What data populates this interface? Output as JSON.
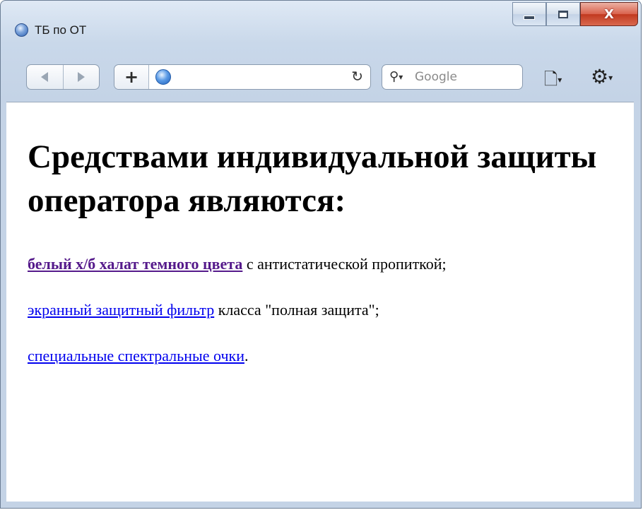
{
  "window": {
    "title": "ТБ по ОТ",
    "controls": {
      "minimize": "minimize",
      "maximize": "maximize",
      "close": "X"
    }
  },
  "toolbar": {
    "plus_label": "+",
    "reload_label": "↻",
    "search_placeholder": "Google"
  },
  "page": {
    "heading": "Средствами индивидуальной защиты оператора являются:",
    "items": [
      {
        "link": "белый х/б халат темного цвета",
        "rest": " с антистатической пропиткой;"
      },
      {
        "link": "экранный защитный фильтр",
        "rest": " класса \"полная защита\";"
      },
      {
        "link": "специальные спектральные очки",
        "rest": "."
      }
    ]
  }
}
